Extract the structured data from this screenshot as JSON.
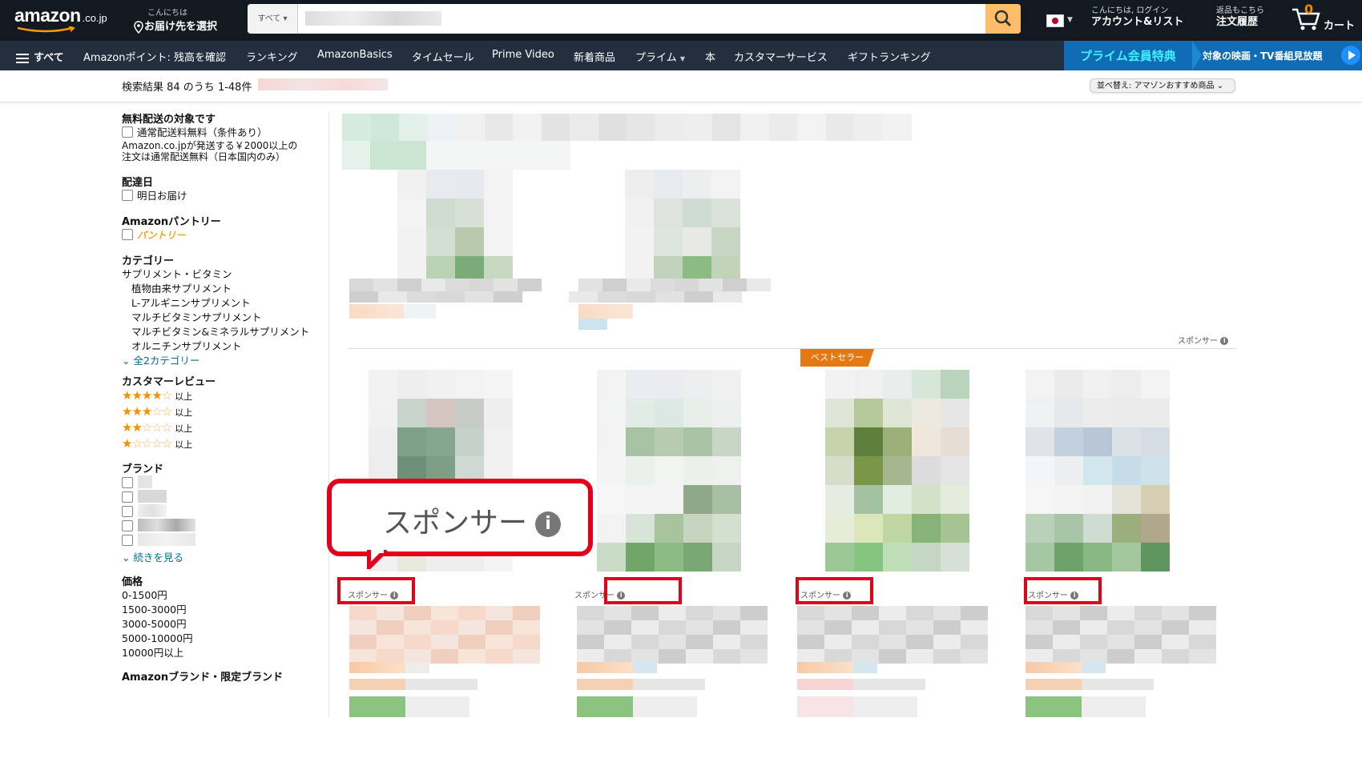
{
  "header": {
    "logo_text": "amazon",
    "logo_tld": ".co.jp",
    "deliver_line1": "こんにちは",
    "deliver_line2": "お届け先を選択",
    "search_category": "すべて",
    "search_value": "",
    "account_line1": "こんにちは, ログイン",
    "account_line2": "アカウント&リスト",
    "orders_line1": "返品もこちら",
    "orders_line2": "注文履歴",
    "cart_count": "0",
    "cart_label": "カート"
  },
  "subnav": {
    "all": "すべて",
    "items": [
      "Amazonポイント: 残高を確認",
      "ランキング",
      "AmazonBasics",
      "タイムセール",
      "Prime Video",
      "新着商品",
      "プライム",
      "本",
      "カスタマーサービス",
      "ギフトランキング"
    ],
    "promo_title": "プライム会員特典",
    "promo_text": "対象の映画・TV番組見放題"
  },
  "results": {
    "count_text": "検索結果 84 のうち 1-48件",
    "sort_label": "並べ替え: アマゾンおすすめ商品"
  },
  "sidebar": {
    "free_shipping_heading": "無料配送の対象です",
    "free_shipping_option": "通常配送料無料（条件あり）",
    "free_shipping_note1": "Amazon.co.jpが発送する￥2000以上の",
    "free_shipping_note2": "注文は通常配送無料（日本国内のみ）",
    "delivery_heading": "配達日",
    "delivery_option": "明日お届け",
    "pantry_heading": "Amazonパントリー",
    "pantry_option": "パントリー",
    "category_heading": "カテゴリー",
    "category_root": "サプリメント・ビタミン",
    "categories": [
      "植物由来サプリメント",
      "L-アルギニンサプリメント",
      "マルチビタミンサプリメント",
      "マルチビタミン&ミネラルサプリメント",
      "オルニチンサプリメント"
    ],
    "category_more": "全2カテゴリー",
    "review_heading": "カスタマーレビュー",
    "review_suffix": "以上",
    "review_levels": [
      4,
      3,
      2,
      1
    ],
    "brand_heading": "ブランド",
    "brand_more": "続きを見る",
    "price_heading": "価格",
    "prices": [
      "0-1500円",
      "1500-3000円",
      "3000-5000円",
      "5000-10000円",
      "10000円以上"
    ],
    "amazon_brand_heading": "Amazonブランド・限定ブランド"
  },
  "main": {
    "sponsor_label": "スポンサー",
    "info_glyph": "i",
    "bestseller_label": "ベストセラー",
    "callout_text": "スポンサー"
  },
  "colors": {
    "nav_bg": "#131921",
    "subnav_bg": "#232f3e",
    "search_button": "#febd69",
    "highlight_red": "#e3001b",
    "bestseller": "#e47911",
    "link": "#007185",
    "star": "#f59000"
  }
}
